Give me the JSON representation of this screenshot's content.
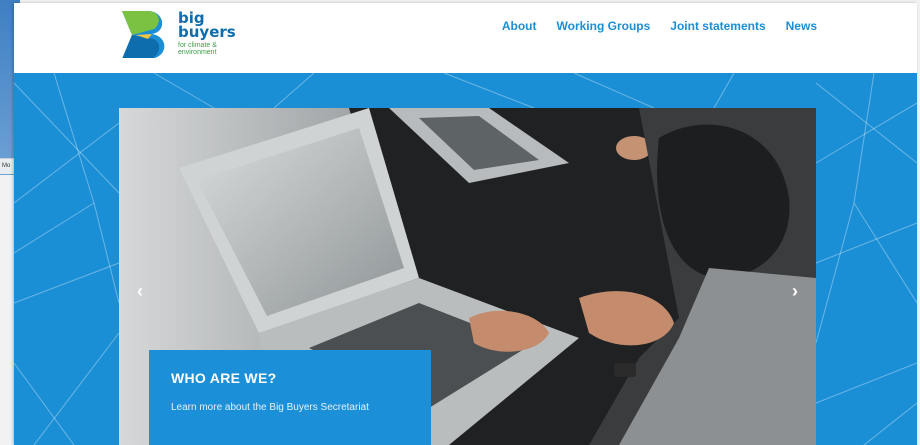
{
  "background_window": {
    "tab_label": "Mo"
  },
  "site": {
    "logo": {
      "line1": "big",
      "line2": "buyers",
      "tagline": "for climate & environment"
    },
    "nav": [
      {
        "label": "About"
      },
      {
        "label": "Working Groups"
      },
      {
        "label": "Joint statements"
      },
      {
        "label": "News"
      }
    ]
  },
  "hero": {
    "prev_symbol": "‹",
    "next_symbol": "›",
    "caption_title": "WHO ARE WE?",
    "caption_link": "Learn more about the Big Buyers Secretariat"
  },
  "colors": {
    "brand_blue": "#1b8fd6",
    "logo_blue": "#0e6dad",
    "logo_green": "#3da04a",
    "nav_blue": "#1c8fd3"
  }
}
